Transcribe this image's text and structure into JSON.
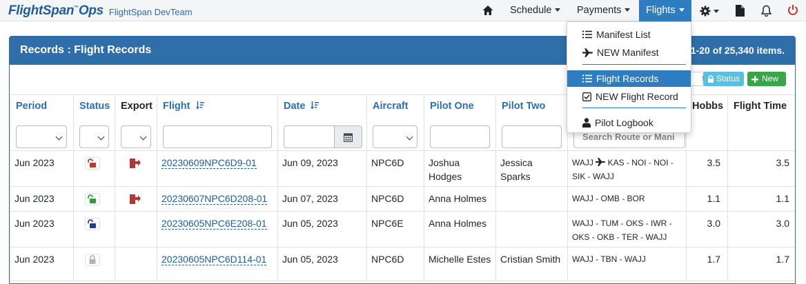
{
  "navbar": {
    "brand": "FlightSpan",
    "brand_suffix": "Ops",
    "brand_tm": "™",
    "team": "FlightSpan DevTeam",
    "menus": {
      "schedule": "Schedule",
      "payments": "Payments",
      "flights": "Flights"
    },
    "icons": [
      "home-icon",
      "gear-icon",
      "document-icon",
      "bell-icon",
      "power-icon"
    ]
  },
  "flights_menu": {
    "items": [
      {
        "label": "Manifest List",
        "icon": "list-icon"
      },
      {
        "label": "NEW Manifest",
        "icon": "plane-icon"
      },
      {
        "label": "Flight Records",
        "icon": "list-icon",
        "active": true
      },
      {
        "label": "NEW Flight Record",
        "icon": "checkbox-icon"
      },
      {
        "label": "Pilot Logbook",
        "icon": "user-icon"
      }
    ]
  },
  "panel": {
    "title": "Records : Flight Records",
    "count": "1-20 of 25,340 items."
  },
  "toolbar": {
    "export_partial": "t",
    "status": "Status",
    "new": "New"
  },
  "table": {
    "columns": [
      "Period",
      "Status",
      "Export",
      "Flight",
      "Date",
      "Aircraft",
      "Pilot One",
      "Pilot Two",
      "",
      "Hobbs",
      "Flight Time"
    ],
    "route_placeholder": "Search Route or Mani",
    "rows": [
      {
        "period": "Jun 2023",
        "status": "unlocked-red",
        "export": true,
        "flight": "20230609NPC6D9-01",
        "date": "Jun 09, 2023",
        "aircraft": "NPC6D",
        "pilot_one": "Joshua Hodges",
        "pilot_two": "Jessica Sparks",
        "route_a": "WAJJ",
        "route_b": "KAS - NOI - NOI - SIK - WAJJ",
        "hobbs": "3.5",
        "flight_time": "3.5"
      },
      {
        "period": "Jun 2023",
        "status": "unlocked-green",
        "export": true,
        "flight": "20230607NPC6D208-01",
        "date": "Jun 07, 2023",
        "aircraft": "NPC6D",
        "pilot_one": "Anna Holmes",
        "pilot_two": "",
        "route_a": "WAJJ - OMB - BOR",
        "route_b": "",
        "hobbs": "1.1",
        "flight_time": "1.1"
      },
      {
        "period": "Jun 2023",
        "status": "unlocked-blue",
        "export": false,
        "flight": "20230605NPC6E208-01",
        "date": "Jun 05, 2023",
        "aircraft": "NPC6E",
        "pilot_one": "Anna Holmes",
        "pilot_two": "",
        "route_a": "WAJJ - TUM - OKS - IWR - OKS - OKB - TER - WAJJ",
        "route_b": "",
        "hobbs": "3.0",
        "flight_time": "3.0"
      },
      {
        "period": "Jun 2023",
        "status": "locked-grey",
        "export": false,
        "flight": "20230605NPC6D114-01",
        "date": "Jun 05, 2023",
        "aircraft": "NPC6D",
        "pilot_one": "Michelle Estes",
        "pilot_two": "Cristian Smith",
        "route_a": "WAJJ - TBN - WAJJ",
        "route_b": "",
        "hobbs": "1.7",
        "flight_time": "1.7"
      }
    ]
  },
  "colors": {
    "brand": "#1f5c9e",
    "header_bg": "#2f6ea8",
    "nav_active": "#2f7dc1",
    "status_btn": "#5bc0de",
    "new_btn": "#3aa548",
    "lock_red": "#c0392b",
    "lock_green": "#2e9e3a",
    "lock_blue": "#1d3f8c",
    "lock_grey": "#b5b5b5"
  }
}
